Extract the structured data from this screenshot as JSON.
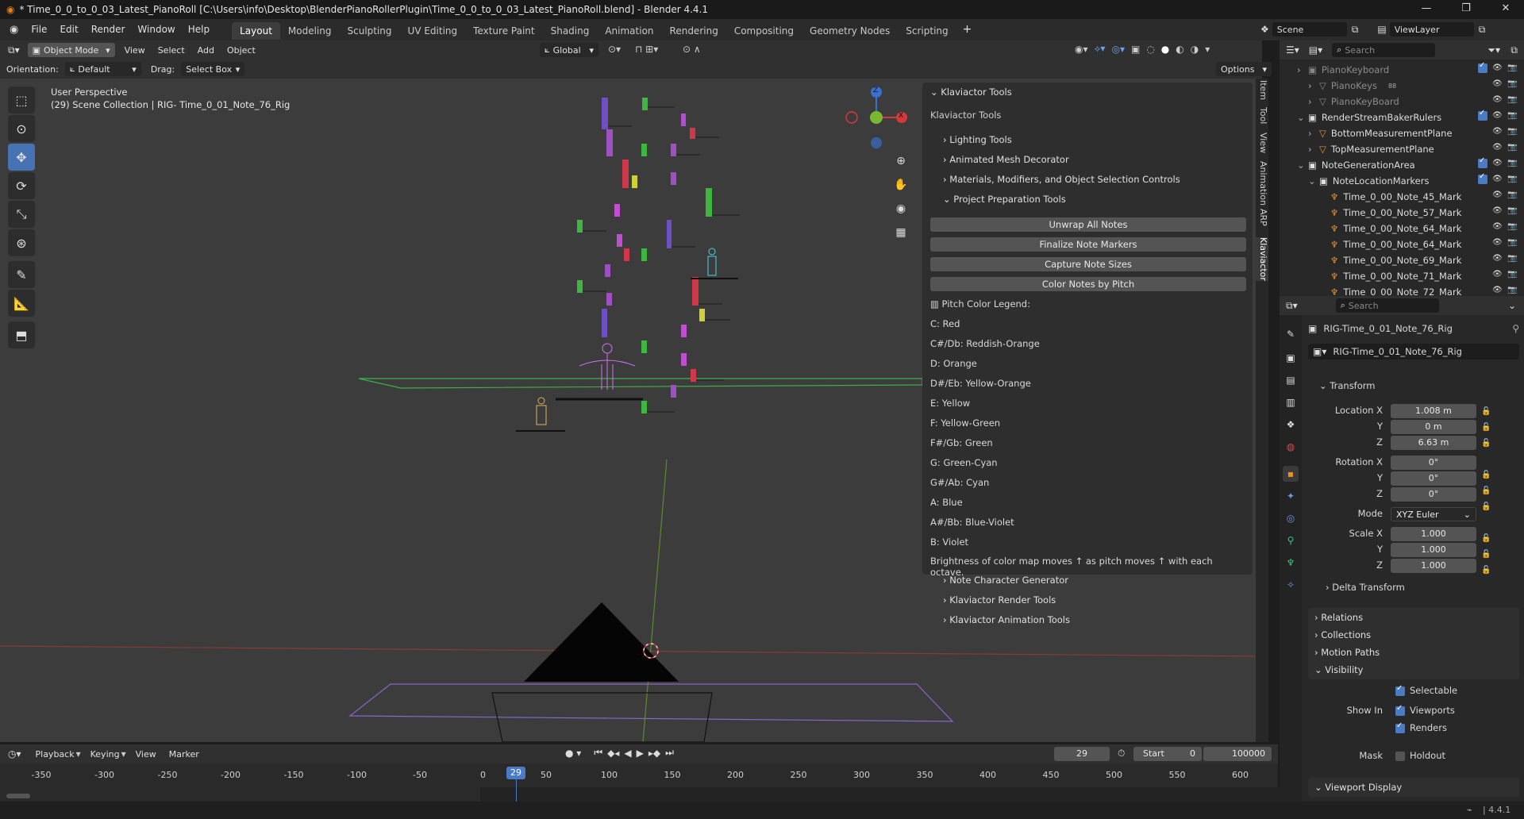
{
  "window": {
    "title": "* Time_0_0_to_0_03_Latest_PianoRoll [C:\\Users\\info\\Desktop\\BlenderPianoRollerPlugin\\Time_0_0_to_0_03_Latest_PianoRoll.blend] - Blender 4.4.1",
    "min": "—",
    "max": "❐",
    "close": "✕"
  },
  "menu": [
    "File",
    "Edit",
    "Render",
    "Window",
    "Help"
  ],
  "workspaces": [
    "Layout",
    "Modeling",
    "Sculpting",
    "UV Editing",
    "Texture Paint",
    "Shading",
    "Animation",
    "Rendering",
    "Compositing",
    "Geometry Nodes",
    "Scripting"
  ],
  "workspace_add": "+",
  "scene": "Scene",
  "view_layer": "ViewLayer",
  "viewport": {
    "mode": "Object Mode",
    "menus": [
      "View",
      "Select",
      "Add",
      "Object"
    ],
    "transform": "Global",
    "orientation_label": "Orientation:",
    "orientation": "Default",
    "drag_label": "Drag:",
    "drag": "Select Box",
    "options": "Options",
    "perspective": "User Perspective",
    "collection_info": "(29) Scene Collection | RIG- Time_0_01_Note_76_Rig",
    "gizmo": {
      "x": "X",
      "y": "Y",
      "z": "Z"
    }
  },
  "side_tabs": [
    "Item",
    "Tool",
    "View",
    "Animation",
    "ARP",
    "Klaviactor"
  ],
  "npanel": {
    "header": "Klaviactor Tools",
    "subheader": "Klaviactor Tools",
    "sections_top": [
      "Lighting Tools",
      "Animated Mesh Decorator",
      "Materials, Modifiers, and Object Selection Controls"
    ],
    "open_section": "Project Preparation Tools",
    "buttons": [
      "Unwrap All Notes",
      "Finalize Note Markers",
      "Capture Note Sizes",
      "Color Notes by Pitch"
    ],
    "legend_title": "Pitch Color Legend:",
    "legend": [
      "C: Red",
      "C#/Db: Reddish-Orange",
      "D: Orange",
      "D#/Eb: Yellow-Orange",
      "E: Yellow",
      "F: Yellow-Green",
      "F#/Gb: Green",
      "G: Green-Cyan",
      "G#/Ab: Cyan",
      "A: Blue",
      "A#/Bb: Blue-Violet",
      "B: Violet"
    ],
    "note": "Brightness of color map moves ↑ as pitch moves ↑ with each octave.",
    "sections_bottom": [
      "Note Character Generator",
      "Klaviactor Render Tools",
      "Klaviactor Animation Tools"
    ]
  },
  "timeline": {
    "menus": [
      "Playback",
      "Keying",
      "View",
      "Marker"
    ],
    "current_frame": "29",
    "start_label": "Start",
    "start": "0",
    "end": "100000",
    "ticks": [
      "-350",
      "-300",
      "-250",
      "-200",
      "-150",
      "-100",
      "-50",
      "0",
      "50",
      "100",
      "150",
      "200",
      "250",
      "300",
      "350",
      "400",
      "450",
      "500",
      "550",
      "600"
    ],
    "playhead": "29"
  },
  "outliner": {
    "search_placeholder": "Search",
    "rows": [
      {
        "label": "PianoKeyboard",
        "indent": 1,
        "dim": true,
        "type": "collection"
      },
      {
        "label": "PianoKeys",
        "indent": 2,
        "dim": true,
        "type": "mesh",
        "badge": "88"
      },
      {
        "label": "PianoKeyBoard",
        "indent": 2,
        "dim": true,
        "type": "mesh"
      },
      {
        "label": "RenderStreamBakerRulers",
        "indent": 1,
        "dim": false,
        "type": "collection"
      },
      {
        "label": "BottomMeasurementPlane",
        "indent": 2,
        "dim": false,
        "type": "mesh"
      },
      {
        "label": "TopMeasurementPlane",
        "indent": 2,
        "dim": false,
        "type": "mesh"
      },
      {
        "label": "NoteGenerationArea",
        "indent": 1,
        "dim": false,
        "type": "collection"
      },
      {
        "label": "NoteLocationMarkers",
        "indent": 2,
        "dim": false,
        "type": "collection"
      },
      {
        "label": "Time_0_00_Note_45_Mark",
        "indent": 3,
        "dim": false,
        "type": "armature"
      },
      {
        "label": "Time_0_00_Note_57_Mark",
        "indent": 3,
        "dim": false,
        "type": "armature"
      },
      {
        "label": "Time_0_00_Note_64_Mark",
        "indent": 3,
        "dim": false,
        "type": "armature"
      },
      {
        "label": "Time_0_00_Note_64_Mark",
        "indent": 3,
        "dim": false,
        "type": "armature"
      },
      {
        "label": "Time_0_00_Note_69_Mark",
        "indent": 3,
        "dim": false,
        "type": "armature"
      },
      {
        "label": "Time_0_00_Note_71_Mark",
        "indent": 3,
        "dim": false,
        "type": "armature"
      },
      {
        "label": "Time_0_00_Note_72_Mark",
        "indent": 3,
        "dim": false,
        "type": "armature"
      }
    ]
  },
  "properties": {
    "search_placeholder": "Search",
    "object_path": "RIG-Time_0_01_Note_76_Rig",
    "object_name": "RIG-Time_0_01_Note_76_Rig",
    "transform": "Transform",
    "location_label": "Location X",
    "loc": [
      "1.008 m",
      "0 m",
      "6.63 m"
    ],
    "rotation_label": "Rotation X",
    "rot": [
      "0°",
      "0°",
      "0°"
    ],
    "mode_label": "Mode",
    "mode": "XYZ Euler",
    "scale_label": "Scale X",
    "scale": [
      "1.000",
      "1.000",
      "1.000"
    ],
    "y": "Y",
    "z": "Z",
    "delta": "Delta Transform",
    "sections": [
      "Relations",
      "Collections",
      "Motion Paths"
    ],
    "visibility": "Visibility",
    "selectable": "Selectable",
    "show_in": "Show In",
    "viewports": "Viewports",
    "renders": "Renders",
    "mask": "Mask",
    "holdout": "Holdout",
    "viewport_display": "Viewport Display"
  },
  "status": {
    "version": "4.4.1"
  }
}
